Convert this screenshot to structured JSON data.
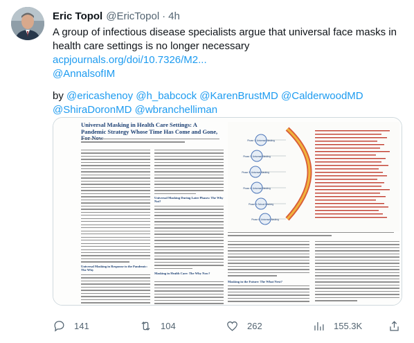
{
  "author": {
    "name": "Eric Topol",
    "handle": "@EricTopol",
    "separator": "·",
    "time": "4h",
    "avatar_icon": "profile-photo"
  },
  "tweet": {
    "text": "A group of infectious disease specialists argue that universal face masks in health care settings is no longer necessary",
    "link": "acpjournals.org/doi/10.7326/M2...",
    "journal_mention": "@AnnalsofIM",
    "by_label": "by",
    "mentions": [
      "@ericashenoy",
      "@h_babcock",
      "@KarenBrustMD",
      "@CalderwoodMD",
      "@ShiraDoronMD",
      "@wbranchelliman"
    ]
  },
  "article": {
    "title": "Universal Masking in Health Care Settings: A Pandemic Strategy Whose Time Has Come and Gone, For Now",
    "section_1": "Universal Masking During Later Phases: The Why Not?",
    "section_2": "Universal Masking in Response to the Pandemic: The Why",
    "section_3": "Masking in the Future: The What Next?",
    "section_4": "Masking in Health Care: The Why Now?",
    "figure_labels": [
      "Phase 1: Universal Masking",
      "Phase 2: Universal Masking",
      "Phase 3: Universal Masking",
      "Phase 4: Universal Masking",
      "Phase 5: School Masking",
      "Phase 6: Universal Masking"
    ]
  },
  "actions": {
    "reply_count": "141",
    "retweet_count": "104",
    "like_count": "262",
    "views_count": "155.3K"
  },
  "colors": {
    "link": "#1d9bf0",
    "text": "#0f1419",
    "muted": "#536471",
    "border": "#cfd9de",
    "paper_heading": "#1b3f73"
  }
}
